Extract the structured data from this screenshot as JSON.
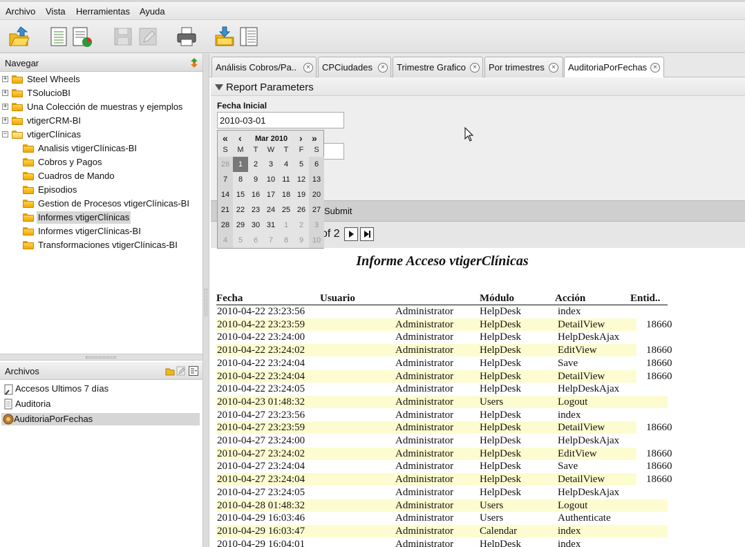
{
  "menubar": {
    "items": [
      "Archivo",
      "Vista",
      "Herramientas",
      "Ayuda"
    ]
  },
  "toolbar": {
    "buttons": [
      "open-folder-icon",
      "new-report-icon",
      "chart-report-icon",
      "save-icon",
      "edit-icon",
      "print-icon",
      "export-icon",
      "columns-icon"
    ]
  },
  "navigator": {
    "title": "Navegar",
    "items": [
      {
        "label": "Steel Wheels",
        "level": 0,
        "expanded": false
      },
      {
        "label": "TSolucioBI",
        "level": 0,
        "expanded": false
      },
      {
        "label": "Una Colección de muestras y ejemplos",
        "level": 0,
        "expanded": false
      },
      {
        "label": "vtigerCRM-BI",
        "level": 0,
        "expanded": false
      },
      {
        "label": "vtigerClínicas",
        "level": 0,
        "expanded": true
      },
      {
        "label": "Analisis vtigerClínicas-BI",
        "level": 1
      },
      {
        "label": "Cobros y Pagos",
        "level": 1
      },
      {
        "label": "Cuadros de Mando",
        "level": 1
      },
      {
        "label": "Episodios",
        "level": 1
      },
      {
        "label": "Gestion de Procesos vtigerClínicas-BI",
        "level": 1
      },
      {
        "label": "Informes vtigerClínicas",
        "level": 1,
        "selected": true
      },
      {
        "label": "Informes vtigerClínicas-BI",
        "level": 1
      },
      {
        "label": "Transformaciones vtigerClínicas-BI",
        "level": 1
      }
    ]
  },
  "files": {
    "title": "Archivos",
    "items": [
      {
        "label": "Accesos Ultimos 7 días",
        "icon": "report-link-icon"
      },
      {
        "label": "Auditoria",
        "icon": "document-icon"
      },
      {
        "label": "AuditoriaPorFechas",
        "icon": "report-run-icon",
        "selected": true
      }
    ]
  },
  "tabs": [
    {
      "label": "Análisis Cobros/Pa..",
      "active": false
    },
    {
      "label": "CPCiudades",
      "active": false
    },
    {
      "label": "Trimestre Grafico",
      "active": false
    },
    {
      "label": "Por trimestres",
      "active": false
    },
    {
      "label": "AuditoriaPorFechas",
      "active": true
    }
  ],
  "params": {
    "header": "Report Parameters",
    "fecha_inicial_label": "Fecha Inicial",
    "fecha_inicial_value": "2010-03-01",
    "fecha_final_value": "",
    "submit_label": "Submit",
    "pager_text": "of 2"
  },
  "calendar": {
    "month_label": "Mar 2010",
    "prev_year": "«",
    "prev_month": "‹",
    "next_month": "›",
    "next_year": "»",
    "day_headers": [
      "S",
      "M",
      "T",
      "W",
      "T",
      "F",
      "S"
    ],
    "weeks": [
      [
        "28",
        "1",
        "2",
        "3",
        "4",
        "5",
        "6"
      ],
      [
        "7",
        "8",
        "9",
        "10",
        "11",
        "12",
        "13"
      ],
      [
        "14",
        "15",
        "16",
        "17",
        "18",
        "19",
        "20"
      ],
      [
        "21",
        "22",
        "23",
        "24",
        "25",
        "26",
        "27"
      ],
      [
        "28",
        "29",
        "30",
        "31",
        "1",
        "2",
        "3"
      ],
      [
        "4",
        "5",
        "6",
        "7",
        "8",
        "9",
        "10"
      ]
    ],
    "selected_day": "1"
  },
  "report": {
    "title": "Informe Acceso vtigerClínicas",
    "columns": [
      "Fecha",
      "Usuario",
      "Módulo",
      "Acción",
      "Entid.."
    ],
    "rows": [
      [
        "2010-04-22 23:23:56",
        "Administrator",
        "HelpDesk",
        "index",
        ""
      ],
      [
        "2010-04-22 23:23:59",
        "Administrator",
        "HelpDesk",
        "DetailView",
        "18660"
      ],
      [
        "2010-04-22 23:24:00",
        "Administrator",
        "HelpDesk",
        "HelpDeskAjax",
        ""
      ],
      [
        "2010-04-22 23:24:02",
        "Administrator",
        "HelpDesk",
        "EditView",
        "18660"
      ],
      [
        "2010-04-22 23:24:04",
        "Administrator",
        "HelpDesk",
        "Save",
        "18660"
      ],
      [
        "2010-04-22 23:24:04",
        "Administrator",
        "HelpDesk",
        "DetailView",
        "18660"
      ],
      [
        "2010-04-22 23:24:05",
        "Administrator",
        "HelpDesk",
        "HelpDeskAjax",
        ""
      ],
      [
        "2010-04-23 01:48:32",
        "Administrator",
        "Users",
        "Logout",
        ""
      ],
      [
        "2010-04-27 23:23:56",
        "Administrator",
        "HelpDesk",
        "index",
        ""
      ],
      [
        "2010-04-27 23:23:59",
        "Administrator",
        "HelpDesk",
        "DetailView",
        "18660"
      ],
      [
        "2010-04-27 23:24:00",
        "Administrator",
        "HelpDesk",
        "HelpDeskAjax",
        ""
      ],
      [
        "2010-04-27 23:24:02",
        "Administrator",
        "HelpDesk",
        "EditView",
        "18660"
      ],
      [
        "2010-04-27 23:24:04",
        "Administrator",
        "HelpDesk",
        "Save",
        "18660"
      ],
      [
        "2010-04-27 23:24:04",
        "Administrator",
        "HelpDesk",
        "DetailView",
        "18660"
      ],
      [
        "2010-04-27 23:24:05",
        "Administrator",
        "HelpDesk",
        "HelpDeskAjax",
        ""
      ],
      [
        "2010-04-28 01:48:32",
        "Administrator",
        "Users",
        "Logout",
        ""
      ],
      [
        "2010-04-29 16:03:46",
        "Administrator",
        "Users",
        "Authenticate",
        ""
      ],
      [
        "2010-04-29 16:03:47",
        "Administrator",
        "Calendar",
        "index",
        ""
      ],
      [
        "2010-04-29 16:04:01",
        "Administrator",
        "HelpDesk",
        "index",
        ""
      ]
    ]
  },
  "colors": {
    "highlight_row": "#fdfcd0",
    "selection": "#d6d6d6",
    "calendar_today": "#777777"
  }
}
